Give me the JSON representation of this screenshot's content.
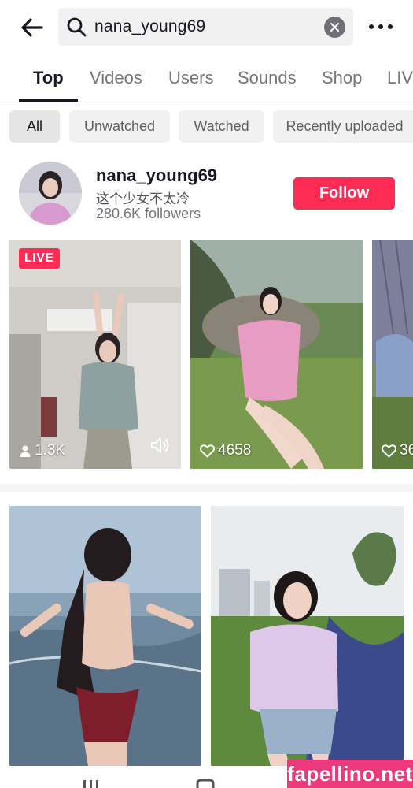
{
  "search": {
    "query": "nana_young69"
  },
  "tabs": [
    {
      "label": "Top"
    },
    {
      "label": "Videos"
    },
    {
      "label": "Users"
    },
    {
      "label": "Sounds"
    },
    {
      "label": "Shop"
    },
    {
      "label": "LIV"
    }
  ],
  "filters": [
    {
      "label": "All"
    },
    {
      "label": "Unwatched"
    },
    {
      "label": "Watched"
    },
    {
      "label": "Recently uploaded"
    }
  ],
  "user": {
    "username": "nana_young69",
    "bio": "这个少女不太冷",
    "followers": "280.6K followers",
    "follow_label": "Follow"
  },
  "videos_row1": [
    {
      "badge": "LIVE",
      "stat": "1.3K",
      "stat_icon": "person-icon"
    },
    {
      "stat": "4658",
      "stat_icon": "heart-icon"
    },
    {
      "stat": "36",
      "stat_icon": "heart-icon"
    }
  ],
  "watermark": "fapellino.net",
  "colors": {
    "accent": "#fe2c55",
    "watermark": "#ec3a7c"
  }
}
